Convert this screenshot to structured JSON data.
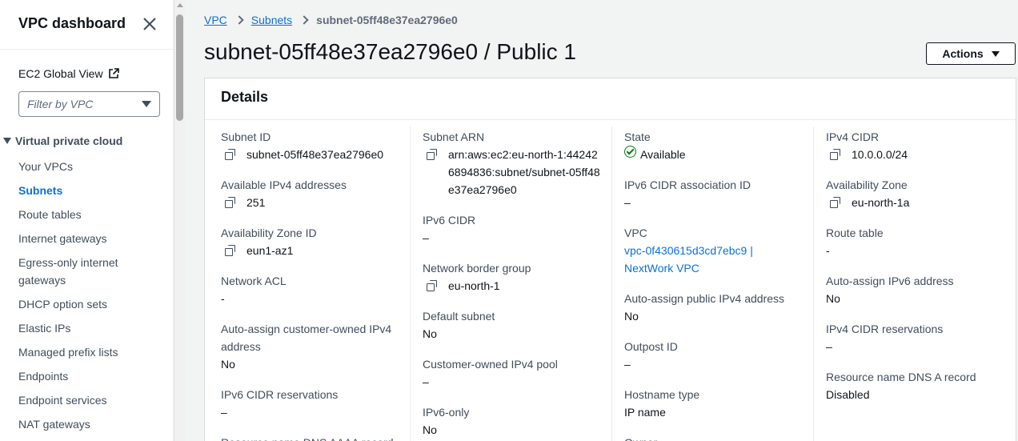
{
  "sidebar": {
    "title": "VPC dashboard",
    "ec2_global": "EC2 Global View",
    "filter_placeholder": "Filter by VPC",
    "section": "Virtual private cloud",
    "items": [
      {
        "label": "Your VPCs"
      },
      {
        "label": "Subnets",
        "active": true
      },
      {
        "label": "Route tables"
      },
      {
        "label": "Internet gateways"
      },
      {
        "label": "Egress-only internet gateways"
      },
      {
        "label": "DHCP option sets"
      },
      {
        "label": "Elastic IPs"
      },
      {
        "label": "Managed prefix lists"
      },
      {
        "label": "Endpoints"
      },
      {
        "label": "Endpoint services"
      },
      {
        "label": "NAT gateways"
      }
    ]
  },
  "breadcrumb": {
    "vpc": "VPC",
    "subnets": "Subnets",
    "current": "subnet-05ff48e37ea2796e0"
  },
  "page_title": "subnet-05ff48e37ea2796e0 / Public 1",
  "actions_label": "Actions",
  "details": {
    "header": "Details",
    "col1": [
      {
        "label": "Subnet ID",
        "value": "subnet-05ff48e37ea2796e0"
      },
      {
        "label": "Available IPv4 addresses",
        "value": "251"
      },
      {
        "label": "Availability Zone ID",
        "value": "eun1-az1"
      },
      {
        "label": "Network ACL",
        "value": "-"
      },
      {
        "label": "Auto-assign customer-owned IPv4 address",
        "value": "No"
      },
      {
        "label": "IPv6 CIDR reservations",
        "value": "–"
      },
      {
        "label": "Resource name DNS AAAA record",
        "value": ""
      }
    ],
    "col2": [
      {
        "label": "Subnet ARN",
        "value": "arn:aws:ec2:eu-north-1:442426894836:subnet/subnet-05ff48e37ea2796e0"
      },
      {
        "label": "IPv6 CIDR",
        "value": "–"
      },
      {
        "label": "Network border group",
        "value": "eu-north-1"
      },
      {
        "label": "Default subnet",
        "value": "No"
      },
      {
        "label": "Customer-owned IPv4 pool",
        "value": "–"
      },
      {
        "label": "IPv6-only",
        "value": "No"
      }
    ],
    "col3": [
      {
        "label": "State",
        "value": "Available"
      },
      {
        "label": "IPv6 CIDR association ID",
        "value": "–"
      },
      {
        "label": "VPC",
        "value": "vpc-0f430615d3cd7ebc9 | NextWork VPC"
      },
      {
        "label": "Auto-assign public IPv4 address",
        "value": "No"
      },
      {
        "label": "Outpost ID",
        "value": "–"
      },
      {
        "label": "Hostname type",
        "value": "IP name"
      },
      {
        "label": "Owner",
        "value": ""
      }
    ],
    "col4": [
      {
        "label": "IPv4 CIDR",
        "value": "10.0.0.0/24"
      },
      {
        "label": "Availability Zone",
        "value": "eu-north-1a"
      },
      {
        "label": "Route table",
        "value": "-"
      },
      {
        "label": "Auto-assign IPv6 address",
        "value": "No"
      },
      {
        "label": "IPv4 CIDR reservations",
        "value": "–"
      },
      {
        "label": "Resource name DNS A record",
        "value": "Disabled"
      }
    ]
  },
  "colors": {
    "link": "#0972d3",
    "success": "#037f0c",
    "text": "#0f141a",
    "muted": "#414d5c"
  }
}
